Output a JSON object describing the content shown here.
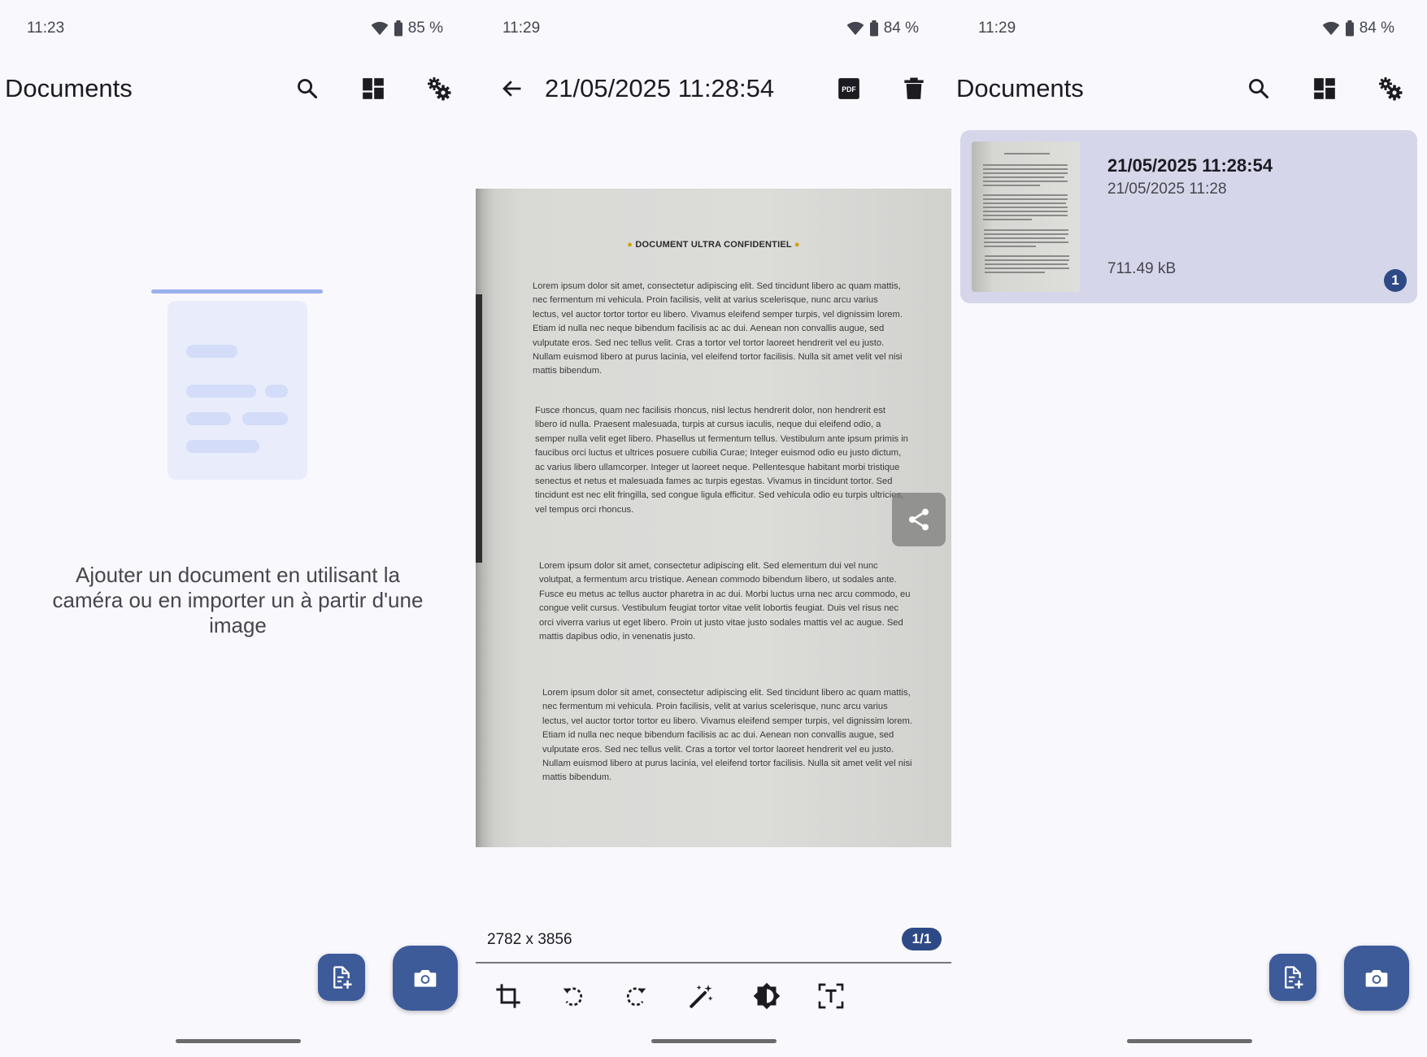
{
  "colors": {
    "background": "#f9f8fd",
    "primary": "#3d5a99",
    "badge": "#2e4a86",
    "card": "#d6d6ea",
    "illustration": "#e9edfb",
    "illustration_accent": "#d3dcf8",
    "illustration_bar": "#9ab1ec"
  },
  "left": {
    "status": {
      "time": "11:23",
      "battery": "85 %"
    },
    "appbar": {
      "title": "Documents",
      "icons": [
        "search-icon",
        "grid-view-icon",
        "settings-icon"
      ]
    },
    "empty_message": "Ajouter un document en utilisant la caméra ou en importer un à partir d'une image",
    "fabs": [
      "import-document-icon",
      "camera-icon"
    ]
  },
  "middle": {
    "status": {
      "time": "11:29",
      "battery": "84 %"
    },
    "appbar": {
      "title": "21/05/2025 11:28:54",
      "icons": [
        "back-arrow-icon",
        "pdf-icon",
        "delete-icon"
      ]
    },
    "document": {
      "heading": "DOCUMENT ULTRA CONFIDENTIEL",
      "paragraphs": [
        "Lorem ipsum dolor sit amet, consectetur adipiscing elit. Sed tincidunt libero ac quam mattis, nec fermentum mi vehicula. Proin facilisis, velit at varius scelerisque, nunc arcu varius lectus, vel auctor tortor tortor eu libero. Vivamus eleifend semper turpis, vel dignissim lorem. Etiam id nulla nec neque bibendum facilisis ac ac dui. Aenean non convallis augue, sed vulputate eros. Sed nec tellus velit. Cras a tortor vel tortor laoreet hendrerit vel eu justo. Nullam euismod libero at purus lacinia, vel eleifend tortor facilisis. Nulla sit amet velit vel nisi mattis bibendum.",
        "Fusce rhoncus, quam nec facilisis rhoncus, nisl lectus hendrerit dolor, non hendrerit est libero id nulla. Praesent malesuada, turpis at cursus iaculis, neque dui eleifend odio, a semper nulla velit eget libero. Phasellus ut fermentum tellus. Vestibulum ante ipsum primis in faucibus orci luctus et ultrices posuere cubilia Curae; Integer euismod odio eu justo dictum, ac varius libero ullamcorper. Integer ut laoreet neque. Pellentesque habitant morbi tristique senectus et netus et malesuada fames ac turpis egestas. Vivamus in tincidunt tortor. Sed tincidunt est nec elit fringilla, sed congue ligula efficitur. Sed vehicula odio eu turpis ultricies, vel tempus orci rhoncus.",
        "Lorem ipsum dolor sit amet, consectetur adipiscing elit. Sed elementum dui vel nunc volutpat, a fermentum arcu tristique. Aenean commodo bibendum libero, ut sodales ante. Fusce eu metus ac tellus auctor pharetra in ac dui. Morbi luctus urna nec arcu commodo, eu congue velit cursus. Vestibulum feugiat tortor vitae velit lobortis feugiat. Duis vel risus nec orci viverra varius ut eget libero. Proin ut justo vitae justo sodales mattis vel ac augue. Sed mattis dapibus odio, in venenatis justo.",
        "Lorem ipsum dolor sit amet, consectetur adipiscing elit. Sed tincidunt libero ac quam mattis, nec fermentum mi vehicula. Proin facilisis, velit at varius scelerisque, nunc arcu varius lectus, vel auctor tortor tortor eu libero. Vivamus eleifend semper turpis, vel dignissim lorem. Etiam id nulla nec neque bibendum facilisis ac ac dui. Aenean non convallis augue, sed vulputate eros. Sed nec tellus velit. Cras a tortor vel tortor laoreet hendrerit vel eu justo. Nullam euismod libero at purus lacinia, vel eleifend tortor facilisis. Nulla sit amet velit vel nisi mattis bibendum."
      ]
    },
    "share_icon": "share-icon",
    "image_dims": "2782 x 3856",
    "page_indicator": "1/1",
    "tools": [
      "crop-icon",
      "rotate-left-icon",
      "rotate-right-icon",
      "magic-wand-icon",
      "contrast-icon",
      "text-recognition-icon"
    ]
  },
  "right": {
    "status": {
      "time": "11:29",
      "battery": "84 %"
    },
    "appbar": {
      "title": "Documents",
      "icons": [
        "search-icon",
        "grid-view-icon",
        "settings-icon"
      ]
    },
    "card": {
      "title": "21/05/2025 11:28:54",
      "date": "21/05/2025 11:28",
      "size": "711.49 kB",
      "page_count": "1"
    },
    "fabs": [
      "import-document-icon",
      "camera-icon"
    ]
  }
}
